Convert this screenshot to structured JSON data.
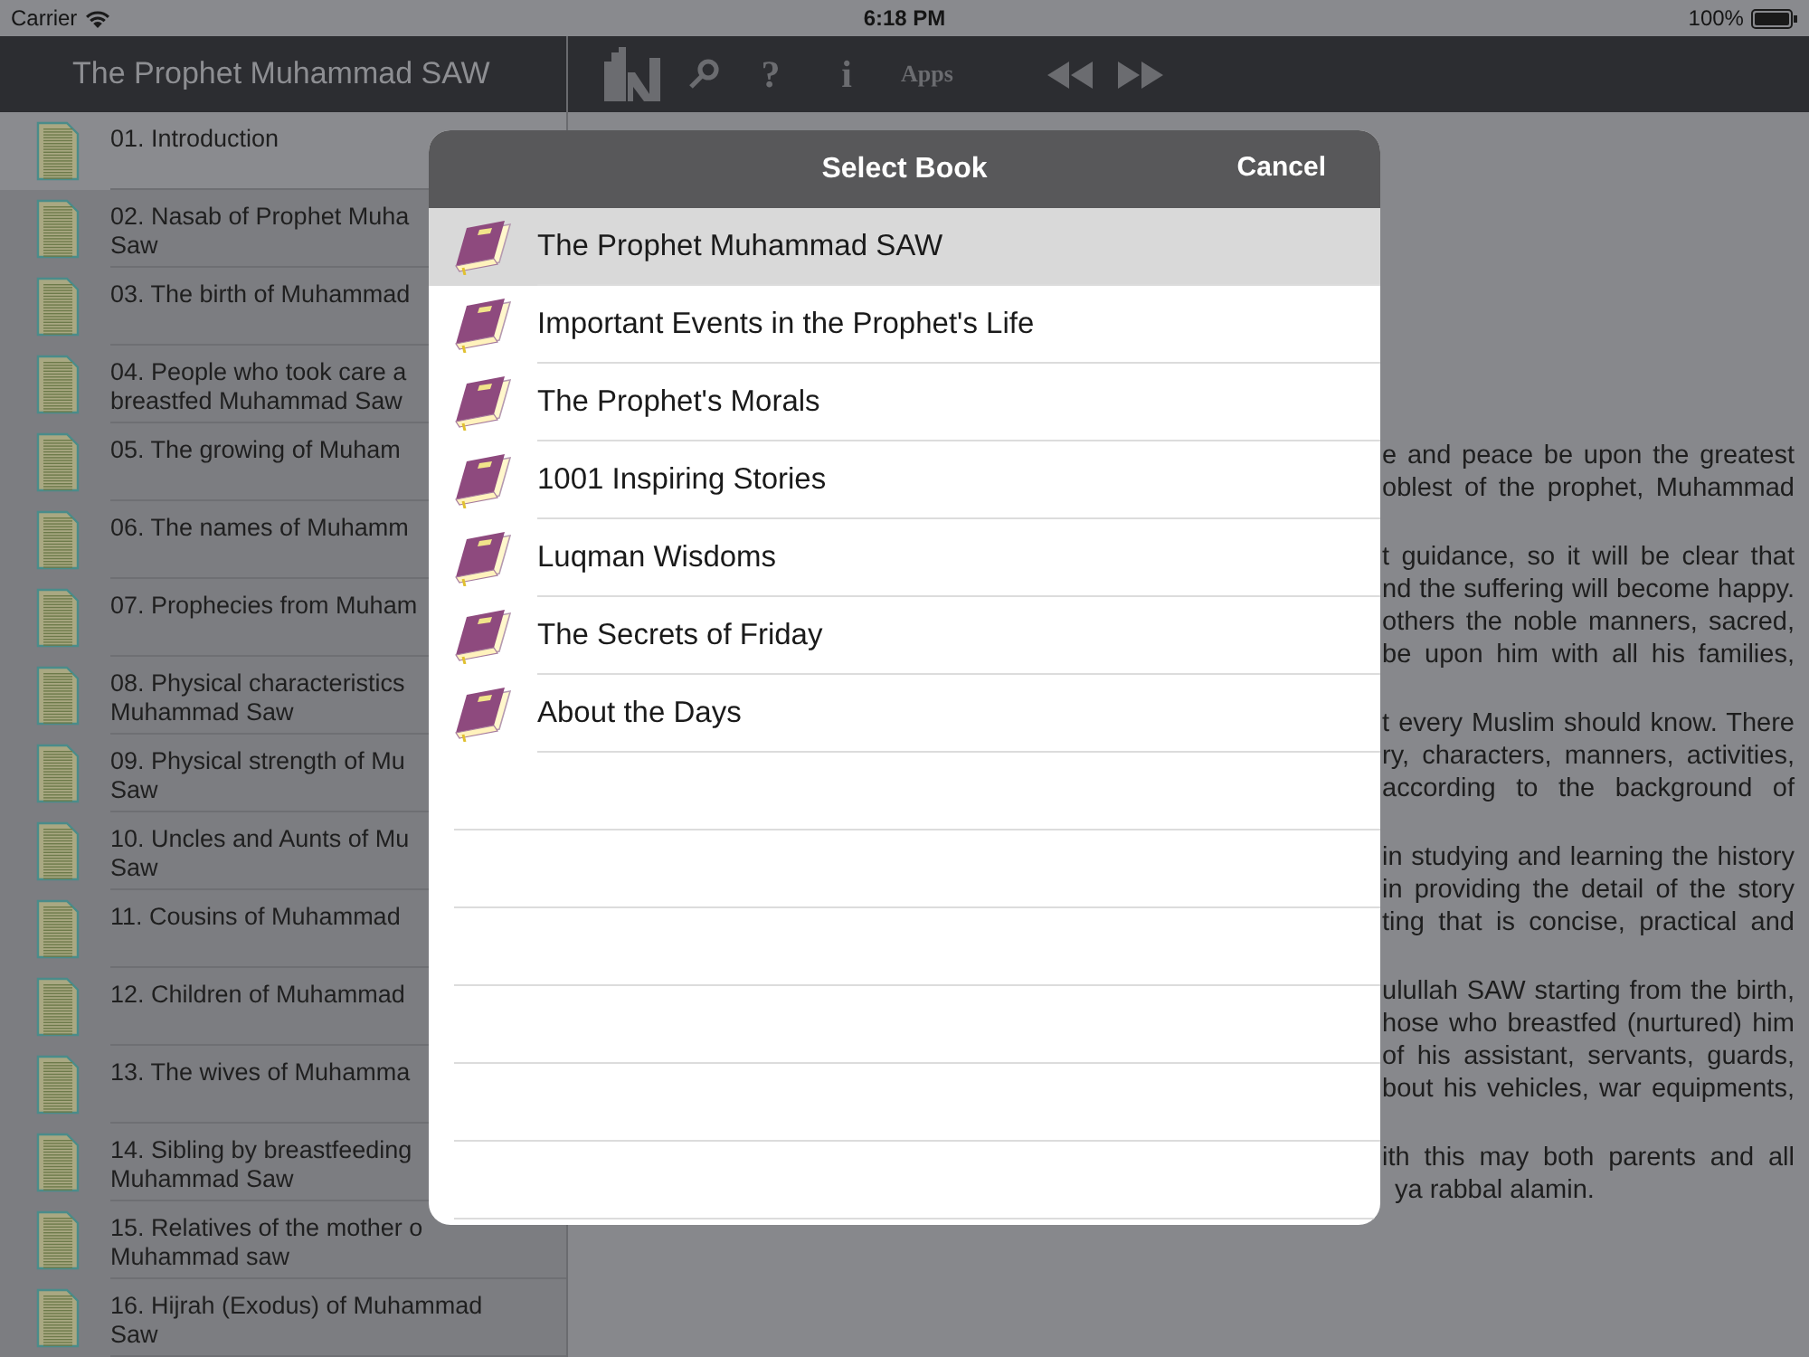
{
  "status_bar": {
    "carrier": "Carrier",
    "time": "6:18 PM",
    "battery": "100%"
  },
  "sidebar": {
    "title": "The Prophet Muhammad SAW",
    "items": [
      {
        "lines": [
          "01. Introduction"
        ],
        "selected": true
      },
      {
        "lines": [
          "02. Nasab of Prophet Muha",
          "Saw"
        ],
        "selected": false
      },
      {
        "lines": [
          "03. The birth of Muhammad"
        ],
        "selected": false
      },
      {
        "lines": [
          "04. People who took care a",
          "breastfed Muhammad Saw"
        ],
        "selected": false
      },
      {
        "lines": [
          "05. The growing of Muham"
        ],
        "selected": false
      },
      {
        "lines": [
          "06. The names of Muhamm"
        ],
        "selected": false
      },
      {
        "lines": [
          "07. Prophecies from Muham"
        ],
        "selected": false
      },
      {
        "lines": [
          "08. Physical characteristics",
          "Muhammad Saw"
        ],
        "selected": false
      },
      {
        "lines": [
          "09. Physical strength of Mu",
          "Saw"
        ],
        "selected": false
      },
      {
        "lines": [
          "10. Uncles and Aunts of Mu",
          "Saw"
        ],
        "selected": false
      },
      {
        "lines": [
          "11. Cousins of Muhammad"
        ],
        "selected": false
      },
      {
        "lines": [
          "12. Children of Muhammad"
        ],
        "selected": false
      },
      {
        "lines": [
          "13. The wives of Muhamma"
        ],
        "selected": false
      },
      {
        "lines": [
          "14. Sibling by breastfeeding",
          "Muhammad Saw"
        ],
        "selected": false
      },
      {
        "lines": [
          "15. Relatives of the mother o",
          "Muhammad saw"
        ],
        "selected": false
      },
      {
        "lines": [
          "16. Hijrah (Exodus) of Muhammad",
          "Saw"
        ],
        "selected": false
      }
    ]
  },
  "toolbar": [
    {
      "kind": "books"
    },
    {
      "kind": "search"
    },
    {
      "kind": "text",
      "label": "?"
    },
    {
      "kind": "text",
      "label": "i"
    },
    {
      "kind": "apps",
      "label": "Apps"
    },
    {
      "kind": "rewind"
    },
    {
      "kind": "forward"
    }
  ],
  "content": {
    "paragraphs": [
      [
        "e and peace be upon the greatest",
        "oblest of the prophet, Muhammad"
      ],
      [
        "t guidance, so it will be clear that",
        "nd the suffering will become happy.",
        "others the noble manners, sacred,",
        "be upon him with all his families,"
      ],
      [
        "t every Muslim should know.  There",
        "ry, characters, manners, activities,",
        "according to the background of"
      ],
      [
        "in studying and learning the history",
        "in providing the detail of the story",
        "ting that is concise, practical and"
      ],
      [
        "ulullah SAW starting from the birth,",
        "hose who breastfed (nurtured) him",
        "of his assistant, servants, guards,",
        "bout his vehicles, war equipments,"
      ],
      [
        "ith this may both parents and all",
        "ya rabbal alamin."
      ]
    ]
  },
  "dialog": {
    "title": "Select Book",
    "cancel": "Cancel",
    "books": [
      {
        "title": "The Prophet Muhammad SAW",
        "selected": true
      },
      {
        "title": "Important Events in the Prophet's Life",
        "selected": false
      },
      {
        "title": "The Prophet's Morals",
        "selected": false
      },
      {
        "title": "1001 Inspiring Stories",
        "selected": false
      },
      {
        "title": "Luqman Wisdoms",
        "selected": false
      },
      {
        "title": "The Secrets of Friday",
        "selected": false
      },
      {
        "title": "About the Days",
        "selected": false
      }
    ]
  }
}
